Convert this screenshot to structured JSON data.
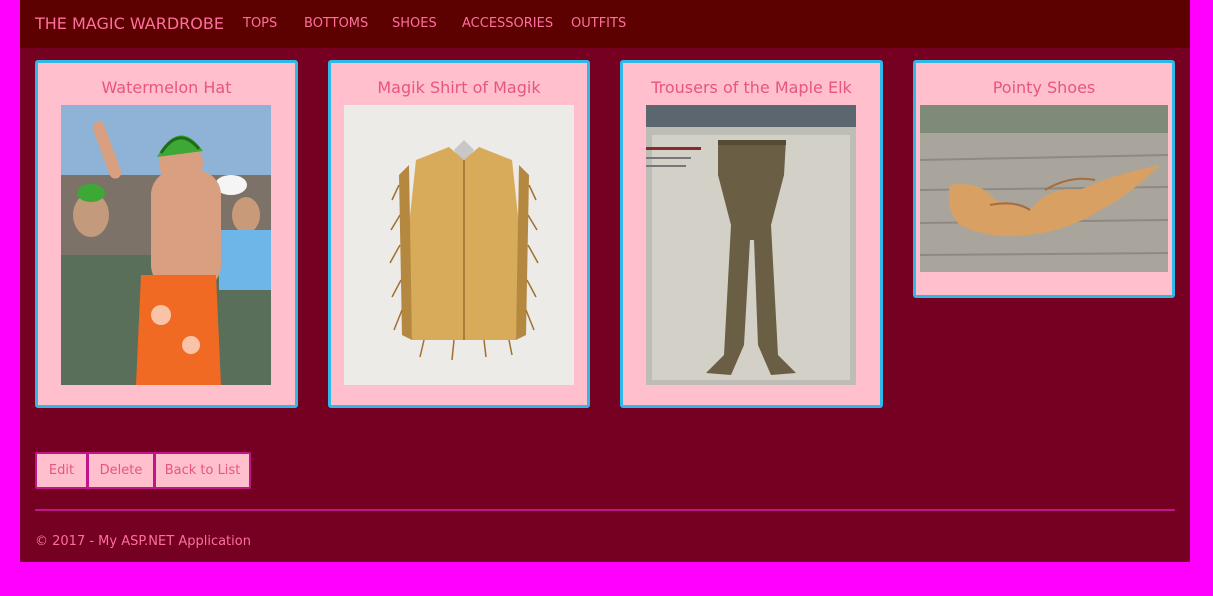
{
  "navbar": {
    "brand": "THE MAGIC WARDROBE",
    "items": [
      {
        "label": "TOPS"
      },
      {
        "label": "BOTTOMS"
      },
      {
        "label": "SHOES"
      },
      {
        "label": "ACCESSORIES"
      },
      {
        "label": "OUTFITS"
      }
    ]
  },
  "cards": [
    {
      "title": "Watermelon Hat"
    },
    {
      "title": "Magik Shirt of Magik"
    },
    {
      "title": "Trousers of the Maple Elk"
    },
    {
      "title": "Pointy Shoes"
    }
  ],
  "actions": {
    "edit": "Edit",
    "delete": "Delete",
    "back": "Back to List"
  },
  "footer": {
    "text": "© 2017 - My ASP.NET Application"
  },
  "colors": {
    "outer_background": "#ff00ff",
    "page_background": "#750021",
    "navbar_background": "#5d0000",
    "card_background": "#ffbfcc",
    "card_border": "#30b8e8",
    "text_pink": "#ff6f9e",
    "card_title": "#e8567a",
    "accent_magenta": "#c0168a"
  }
}
